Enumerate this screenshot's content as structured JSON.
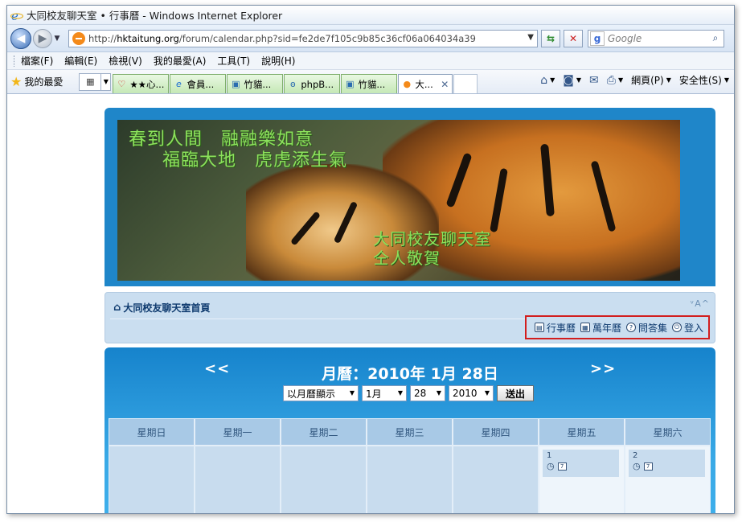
{
  "window": {
    "title": "大同校友聊天室 • 行事曆 - Windows Internet Explorer"
  },
  "address": {
    "prefix": "http://",
    "host": "hktaitung.org",
    "path": "/forum/calendar.php?sid=fe2de7f105c9b85c36cf06a064034a39"
  },
  "search": {
    "placeholder": "Google"
  },
  "menu": {
    "items": [
      "檔案(F)",
      "編輯(E)",
      "檢視(V)",
      "我的最愛(A)",
      "工具(T)",
      "說明(H)"
    ]
  },
  "favorites": {
    "label": "我的最愛",
    "tabs": [
      {
        "label": "★★心...",
        "icon": "heart-icon"
      },
      {
        "label": "會員...",
        "icon": "ie-icon"
      },
      {
        "label": "竹貓...",
        "icon": "page-icon"
      },
      {
        "label": "phpB...",
        "icon": "users-icon"
      },
      {
        "label": "竹貓...",
        "icon": "page-icon"
      },
      {
        "label": "大...",
        "icon": "site-icon"
      }
    ],
    "commands": [
      "網頁(P)",
      "安全性(S)"
    ]
  },
  "banner": {
    "line1": "春到人間　融融樂如意",
    "line2": "福臨大地　虎虎添生氣",
    "line3": "大同校友聊天室",
    "line4": "仝人敬賀"
  },
  "breadcrumb": {
    "home": "大同校友聊天室首頁",
    "fontsize": "ᵛA^"
  },
  "quicklinks": [
    "行事曆",
    "萬年曆",
    "問答集",
    "登入"
  ],
  "calendar": {
    "title": "月曆：2010年 1月 28日",
    "prev": "<<",
    "next": ">>",
    "view_select": "以月曆顯示",
    "month_select": "1月",
    "day_select": "28",
    "year_select": "2010",
    "submit": "送出",
    "weekdays": [
      "星期日",
      "星期一",
      "星期二",
      "星期三",
      "星期四",
      "星期五",
      "星期六"
    ],
    "days": [
      {
        "date": ""
      },
      {
        "date": ""
      },
      {
        "date": ""
      },
      {
        "date": ""
      },
      {
        "date": ""
      },
      {
        "date": "1",
        "badge": "7"
      },
      {
        "date": "2",
        "badge": "7"
      }
    ]
  }
}
